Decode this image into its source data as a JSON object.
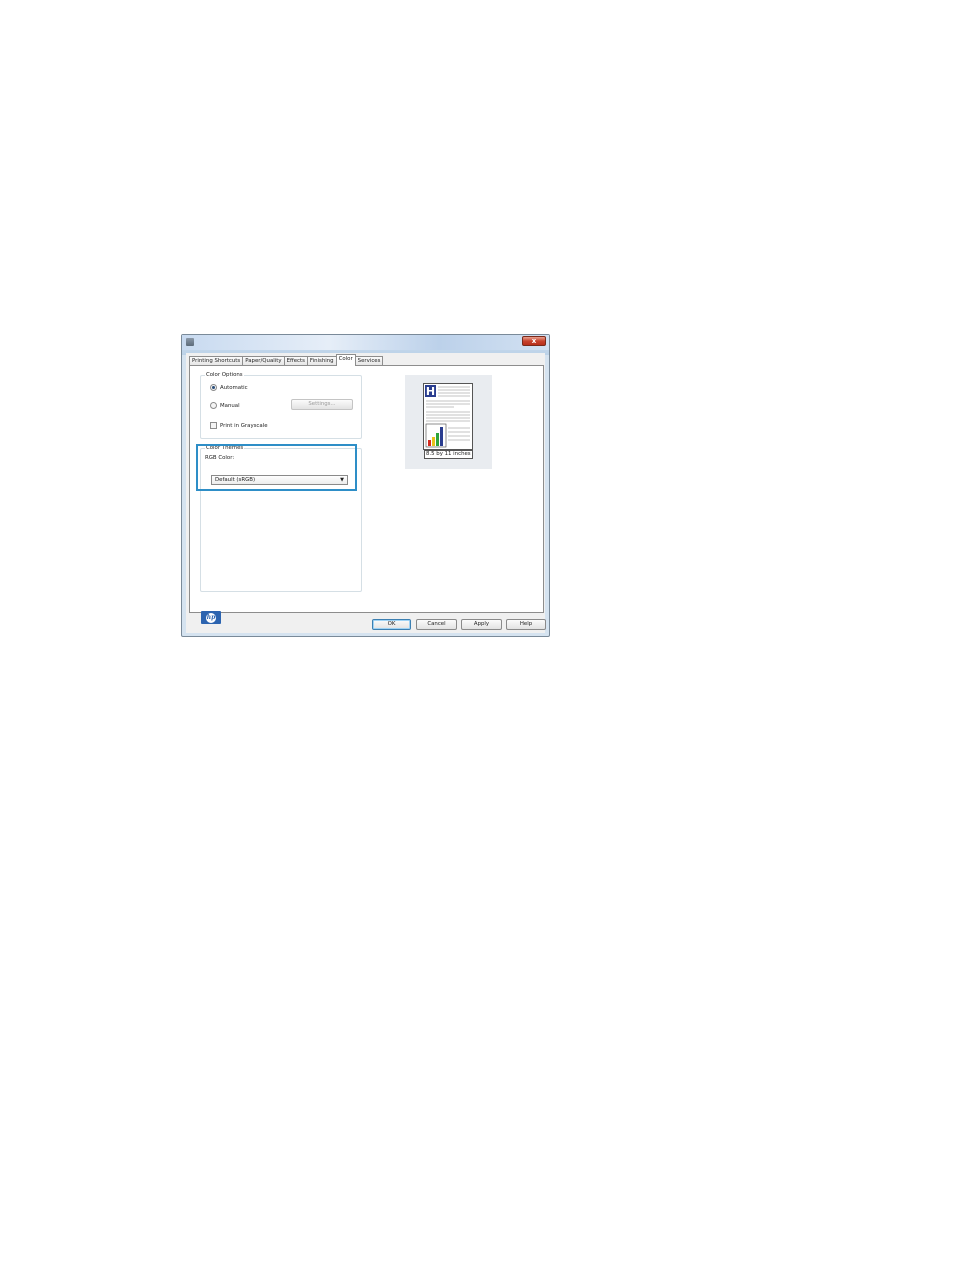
{
  "window": {
    "close_glyph": "x"
  },
  "tabs": [
    {
      "label": "Printing Shortcuts"
    },
    {
      "label": "Paper/Quality"
    },
    {
      "label": "Effects"
    },
    {
      "label": "Finishing"
    },
    {
      "label": "Color",
      "active": true
    },
    {
      "label": "Services"
    }
  ],
  "color_options": {
    "legend": "Color Options",
    "automatic": {
      "label": "Automatic",
      "selected": true
    },
    "manual": {
      "label": "Manual",
      "selected": false
    },
    "settings_label": "Settings...",
    "grayscale": {
      "label": "Print in Grayscale",
      "checked": false
    }
  },
  "color_themes": {
    "legend": "Color Themes",
    "rgb_label": "RGB Color:",
    "rgb_value": "Default (sRGB)"
  },
  "preview": {
    "size_label": "8.5 by 11 inches"
  },
  "buttons": {
    "ok": "OK",
    "cancel": "Cancel",
    "apply": "Apply",
    "help": "Help"
  },
  "logo": {
    "text": "hp"
  },
  "colors": {
    "highlight": "#2e8ec7",
    "logo_blue": "#2c64b0"
  }
}
